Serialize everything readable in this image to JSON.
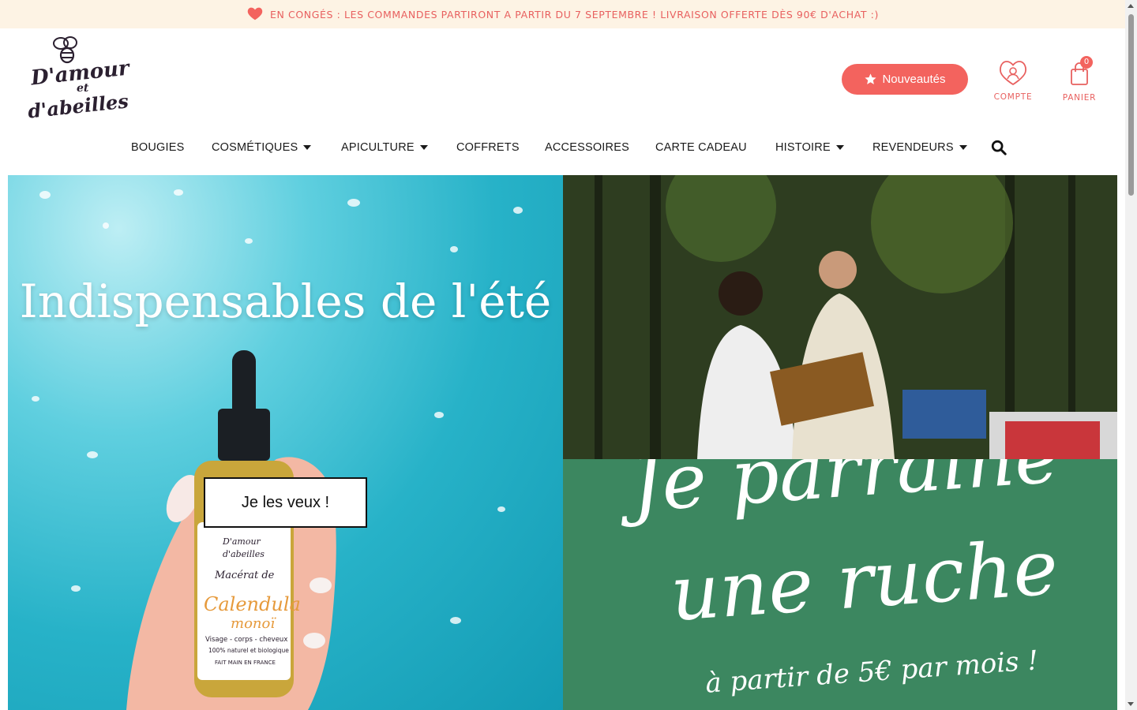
{
  "announcement": {
    "text": "EN CONGÉS : LES COMMANDES PARTIRONT A PARTIR DU 7 SEPTEMBRE ! LIVRAISON OFFERTE DÈS 90€ D'ACHAT :)",
    "icon": "heart-icon",
    "color": "#e8605f"
  },
  "brand": {
    "line1": "D'amour",
    "line2": "et",
    "line3": "d'abeilles"
  },
  "header": {
    "new_button": "Nouveautés",
    "account_label": "COMPTE",
    "cart_label": "PANIER",
    "cart_count": "0",
    "accent": "#f3635e"
  },
  "nav": {
    "items": [
      {
        "label": "BOUGIES"
      },
      {
        "label": "COSMÉTIQUES"
      },
      {
        "label": "APICULTURE"
      },
      {
        "label": "COFFRETS"
      },
      {
        "label": "ACCESSOIRES"
      },
      {
        "label": "CARTE CADEAU"
      },
      {
        "label": "HISTOIRE"
      },
      {
        "label": "REVENDEURS"
      }
    ]
  },
  "hero_left": {
    "title": "Indispensables de l'été",
    "cta": "Je les veux !",
    "bottle_brand_1": "D'amour",
    "bottle_brand_2": "d'abeilles",
    "bottle_label_1": "Macérat de",
    "bottle_label_2": "Calendula",
    "bottle_label_3": "monoï",
    "bottle_small_1": "Visage - corps - cheveux",
    "bottle_small_2": "100% naturel et biologique",
    "bottle_small_3": "FAIT MAIN EN FRANCE"
  },
  "hero_right": {
    "line1": "Je parraine",
    "line2": "une ruche",
    "line3": "à partir de 5€ par mois !",
    "green": "#3c8760"
  }
}
